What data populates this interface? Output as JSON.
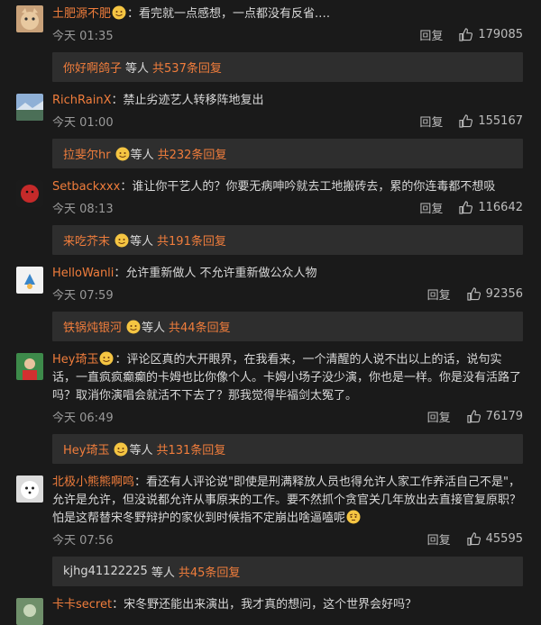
{
  "colors": {
    "accent": "#f07d3c",
    "background": "#1a1a1a",
    "reply_box": "#2e2e2e",
    "muted": "#9a9a9a"
  },
  "labels": {
    "reply": "回复",
    "etc": "等人"
  },
  "comments": [
    {
      "user": "土肥源不肥",
      "badge": "emoji",
      "text": "看完就一点感想，一点都没有反省.…",
      "time": "今天 01:35",
      "likes": "179085",
      "replies": {
        "name": "你好啊鸽子",
        "name_badge": false,
        "count": "共537条回复"
      }
    },
    {
      "user": "RichRainX",
      "badge": "",
      "text": "禁止劣迹艺人转移阵地复出",
      "time": "今天 01:00",
      "likes": "155167",
      "replies": {
        "name": "拉斐尔hr",
        "name_badge": true,
        "count": "共232条回复"
      }
    },
    {
      "user": "Setbackxxx",
      "badge": "",
      "text": "谁让你干艺人的？你要无病呻吟就去工地搬砖去，累的你连毒都不想吸",
      "time": "今天 08:13",
      "likes": "116642",
      "replies": {
        "name": "来吃芥末",
        "name_badge": true,
        "count": "共191条回复"
      }
    },
    {
      "user": "HelloWanli",
      "badge": "",
      "text": "允许重新做人 不允许重新做公众人物",
      "time": "今天 07:59",
      "likes": "92356",
      "replies": {
        "name": "铁锅炖银河",
        "name_badge": true,
        "count": "共44条回复"
      }
    },
    {
      "user": "Hey琦玉",
      "badge": "emoji",
      "text": "评论区真的大开眼界，在我看来，一个清醒的人说不出以上的话，说句实话，一直疯疯癫癫的卡姆也比你像个人。卡姆小场子没少演，你也是一样。你是没有活路了吗？取消你演唱会就活不下去了？那我觉得毕福剑太冤了。",
      "time": "今天 06:49",
      "likes": "76179",
      "replies": {
        "name": "Hey琦玉",
        "name_badge": true,
        "count": "共131条回复"
      }
    },
    {
      "user": "北极小熊熊啊鸣",
      "badge": "",
      "text": "看还有人评论说\"即使是刑满释放人员也得允许人家工作养活自己不是\"，允许是允许，但没说都允许从事原来的工作。要不然抓个贪官关几年放出去直接官复原职？怕是这帮替宋冬野辩护的家伙到时候指不定崩出啥逼嗑呢",
      "text_emoji": true,
      "time": "今天 07:56",
      "likes": "45595",
      "replies": {
        "name": "kjhg41122225",
        "name_badge": false,
        "count": "共45条回复"
      }
    },
    {
      "user": "卡卡secret",
      "badge": "",
      "text": "宋冬野还能出来演出，我才真的想问，这个世界会好吗？",
      "time": "",
      "likes": ""
    }
  ]
}
